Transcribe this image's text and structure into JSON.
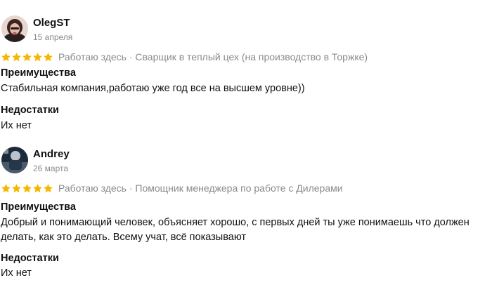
{
  "reviews": [
    {
      "author": "OlegST",
      "date": "15 апреля",
      "rating": 5,
      "meta": "Работаю здесь · Сварщик в теплый цех (на производство в Торжке)",
      "pros_title": "Преимущества",
      "pros_text": "Стабильная компания,работаю уже год все на высшем уровне))",
      "cons_title": "Недостатки",
      "cons_text": "Их нет"
    },
    {
      "author": "Andrey",
      "date": "26 марта",
      "rating": 5,
      "meta": "Работаю здесь · Помощник менеджера по работе с Дилерами",
      "pros_title": "Преимущества",
      "pros_text_line1": "Добрый и понимающий человек, объясняет хорошо, с первых дней ты уже понимаешь что должен",
      "pros_text_line2": "делать, как это делать. Всему учат, всё показывают",
      "cons_title": "Недостатки",
      "cons_text": "Их нет"
    }
  ],
  "colors": {
    "star": "#F5B800",
    "muted": "#8A8A8A",
    "text": "#111111"
  }
}
